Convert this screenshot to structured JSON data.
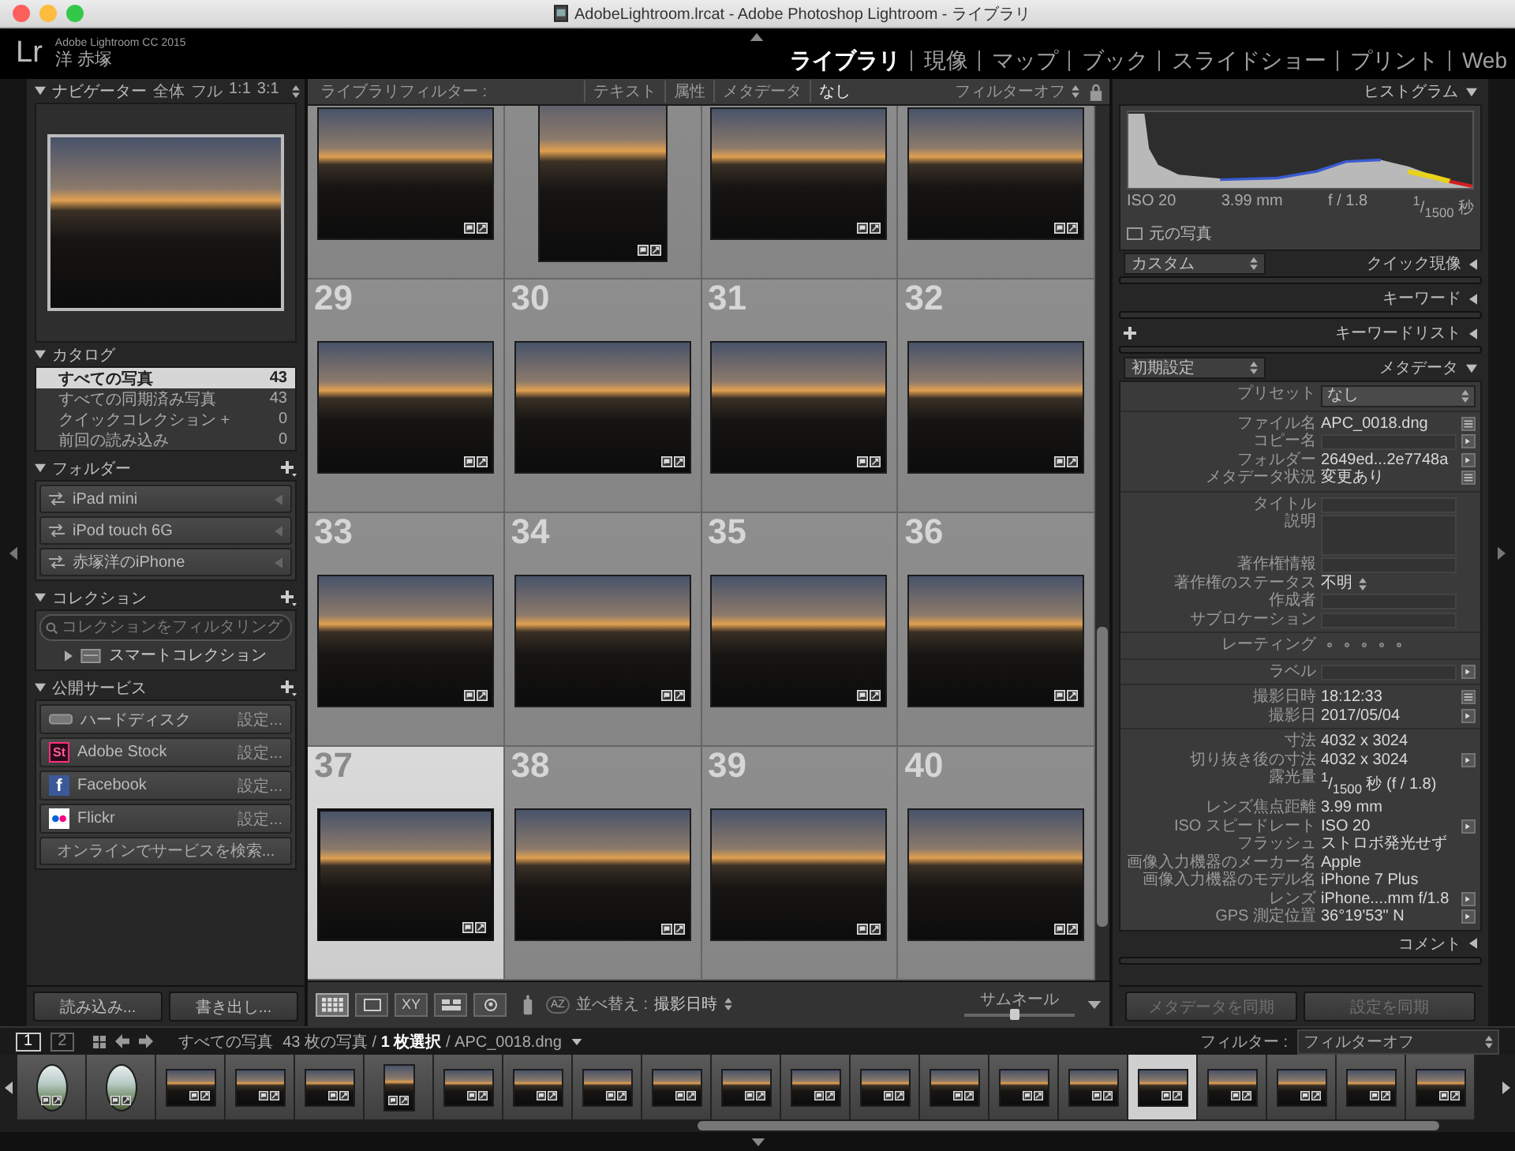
{
  "window": {
    "title": "AdobeLightroom.lrcat - Adobe Photoshop Lightroom - ライブラリ"
  },
  "identity": {
    "logo": "Lr",
    "product": "Adobe Lightroom CC 2015",
    "user": "洋 赤塚"
  },
  "modules": [
    {
      "label": "ライブラリ",
      "selected": true
    },
    {
      "label": "現像",
      "selected": false
    },
    {
      "label": "マップ",
      "selected": false
    },
    {
      "label": "ブック",
      "selected": false
    },
    {
      "label": "スライドショー",
      "selected": false
    },
    {
      "label": "プリント",
      "selected": false
    },
    {
      "label": "Web",
      "selected": false
    }
  ],
  "left_panel": {
    "navigator": {
      "title": "ナビゲーター",
      "zoom_options": [
        "全体",
        "フル",
        "1:1",
        "3:1"
      ]
    },
    "catalog": {
      "title": "カタログ",
      "items": [
        {
          "label": "すべての写真",
          "count": "43",
          "selected": true
        },
        {
          "label": "すべての同期済み写真",
          "count": "43",
          "selected": false
        },
        {
          "label": "クイックコレクション +",
          "count": "0",
          "selected": false
        },
        {
          "label": "前回の読み込み",
          "count": "0",
          "selected": false
        }
      ]
    },
    "folders": {
      "title": "フォルダー",
      "items": [
        "iPad mini",
        "iPod touch 6G",
        "赤塚洋のiPhone"
      ]
    },
    "collections": {
      "title": "コレクション",
      "filter": {
        "placeholder": "コレクションをフィルタリング"
      },
      "items": [
        "スマートコレクション"
      ]
    },
    "publish_services": {
      "title": "公開サービス",
      "items": [
        {
          "kind": "disk",
          "label": "ハードディスク",
          "action": "設定..."
        },
        {
          "kind": "stock",
          "logo_text": "St",
          "label": "Adobe Stock",
          "action": "設定..."
        },
        {
          "kind": "facebook",
          "logo_text": "f",
          "label": "Facebook",
          "action": "設定..."
        },
        {
          "kind": "flickr",
          "label": "Flickr",
          "action": "設定..."
        }
      ],
      "search_button": "オンラインでサービスを検索..."
    },
    "buttons": [
      "読み込み...",
      "書き出し..."
    ]
  },
  "filter_bar": {
    "label": "ライブラリフィルター :",
    "options": [
      {
        "label": "テキスト",
        "selected": false
      },
      {
        "label": "属性",
        "selected": false
      },
      {
        "label": "メタデータ",
        "selected": false
      },
      {
        "label": "なし",
        "selected": true
      }
    ],
    "preset": "フィルターオフ"
  },
  "grid": {
    "cells": [
      {
        "selected": false,
        "portrait": false
      },
      {
        "selected": false,
        "portrait": true
      },
      {
        "selected": false,
        "portrait": false
      },
      {
        "selected": false,
        "portrait": false
      },
      {
        "number": "29",
        "selected": false,
        "portrait": false
      },
      {
        "number": "30",
        "selected": false,
        "portrait": false
      },
      {
        "number": "31",
        "selected": false,
        "portrait": false
      },
      {
        "number": "32",
        "selected": false,
        "portrait": false
      },
      {
        "number": "33",
        "selected": false,
        "portrait": false
      },
      {
        "number": "34",
        "selected": false,
        "portrait": false
      },
      {
        "number": "35",
        "selected": false,
        "portrait": false
      },
      {
        "number": "36",
        "selected": false,
        "portrait": false
      },
      {
        "number": "37",
        "selected": true,
        "portrait": false
      },
      {
        "number": "38",
        "selected": false,
        "portrait": false
      },
      {
        "number": "39",
        "selected": false,
        "portrait": false
      },
      {
        "number": "40",
        "selected": false,
        "portrait": false
      }
    ]
  },
  "toolbar": {
    "view_modes": [
      {
        "kind": "grid",
        "selected": true
      },
      {
        "kind": "loupe",
        "selected": false
      },
      {
        "kind": "compare",
        "glyph": "XY",
        "selected": false
      },
      {
        "kind": "survey",
        "selected": false
      },
      {
        "kind": "people",
        "selected": false
      }
    ],
    "sort_order": "AZ",
    "sort_label": "並べ替え :",
    "sort_value": "撮影日時",
    "thumbnail_label": "サムネール",
    "thumbnail_slider": {
      "level": 0.45
    }
  },
  "right_panel": {
    "histogram": {
      "title": "ヒストグラム",
      "readings": [
        "ISO 20",
        "3.99 mm",
        "f / 1.8",
        "$^{1}$/$_{1500}$ 秒"
      ],
      "original_photo": {
        "label": "元の写真",
        "checked": false
      }
    },
    "quick_develop": {
      "preset": "カスタム",
      "title": "クイック現像"
    },
    "keywording": {
      "title": "キーワード"
    },
    "keyword_list": {
      "title": "キーワードリスト"
    },
    "metadata": {
      "preset": "初期設定",
      "title": "メタデータ",
      "preset_row": {
        "label": "プリセット",
        "value": "なし"
      },
      "groups": [
        [
          {
            "kind": "text",
            "label": "ファイル名",
            "value": "APC_0018.dng",
            "button": {
              "kind": "list"
            }
          },
          {
            "kind": "field",
            "label": "コピー名",
            "button": {
              "kind": "go"
            }
          },
          {
            "kind": "text",
            "label": "フォルダー",
            "value": "2649ed...2e7748a",
            "button": {
              "kind": "go"
            }
          },
          {
            "kind": "text",
            "label": "メタデータ状況",
            "value": "変更あり",
            "button": {
              "kind": "list"
            }
          }
        ],
        [
          {
            "kind": "field",
            "label": "タイトル"
          },
          {
            "kind": "area",
            "label": "説明"
          },
          {
            "kind": "field",
            "label": "著作権情報"
          },
          {
            "kind": "status",
            "label": "著作権のステータス",
            "value": "不明"
          },
          {
            "kind": "field",
            "label": "作成者"
          },
          {
            "kind": "field",
            "label": "サブロケーション"
          }
        ],
        [
          {
            "kind": "rating",
            "label": "レーティング",
            "stars": 0
          }
        ],
        [
          {
            "kind": "field",
            "label": "ラベル",
            "button": {
              "kind": "go"
            }
          }
        ],
        [
          {
            "kind": "text",
            "label": "撮影日時",
            "value": "18:12:33",
            "button": {
              "kind": "list"
            }
          },
          {
            "kind": "text",
            "label": "撮影日",
            "value": "2017/05/04",
            "button": {
              "kind": "go"
            }
          }
        ],
        [
          {
            "kind": "text",
            "label": "寸法",
            "value": "4032 x 3024"
          },
          {
            "kind": "text",
            "label": "切り抜き後の寸法",
            "value": "4032 x 3024",
            "button": {
              "kind": "go"
            }
          },
          {
            "kind": "text",
            "label": "露光量",
            "value": "$^{1}$/$_{1500}$ 秒 (f / 1.8)"
          },
          {
            "kind": "text",
            "label": "レンズ焦点距離",
            "value": "3.99 mm"
          },
          {
            "kind": "text",
            "label": "ISO スピードレート",
            "value": "ISO 20",
            "button": {
              "kind": "go"
            }
          },
          {
            "kind": "text",
            "label": "フラッシュ",
            "value": "ストロボ発光せず"
          },
          {
            "kind": "text",
            "label": "画像入力機器のメーカー名",
            "value": "Apple"
          },
          {
            "kind": "text",
            "label": "画像入力機器のモデル名",
            "value": "iPhone 7 Plus"
          },
          {
            "kind": "text",
            "label": "レンズ",
            "value": "iPhone....mm f/1.8",
            "button": {
              "kind": "go"
            }
          },
          {
            "kind": "text",
            "label": "GPS 測定位置",
            "value": "36°19'53\" N",
            "button": {
              "kind": "go"
            }
          }
        ]
      ]
    },
    "comments": {
      "title": "コメント"
    },
    "sync_buttons": [
      {
        "label": "メタデータを同期",
        "disabled": true
      },
      {
        "label": "設定を同期",
        "disabled": true
      }
    ]
  },
  "filmstrip": {
    "pages": [
      {
        "label": "1",
        "selected": true
      },
      {
        "label": "2",
        "selected": false
      }
    ],
    "source": "すべての写真",
    "info": "43 枚の写真 / **1 枚選択** / APC_0018.dng",
    "filter_label": "フィルター :",
    "filter_value": "フィルターオフ",
    "thumbnails": [
      {
        "kind": "light",
        "portrait": true,
        "selected": false
      },
      {
        "kind": "light",
        "portrait": true,
        "selected": false
      },
      {
        "kind": "dark",
        "portrait": false,
        "selected": false
      },
      {
        "kind": "dark",
        "portrait": false,
        "selected": false
      },
      {
        "kind": "dark",
        "portrait": false,
        "selected": false
      },
      {
        "kind": "dark",
        "portrait": true,
        "selected": false
      },
      {
        "kind": "dark",
        "portrait": false,
        "selected": false
      },
      {
        "kind": "dark",
        "portrait": false,
        "selected": false
      },
      {
        "kind": "dark",
        "portrait": false,
        "selected": false
      },
      {
        "kind": "dark",
        "portrait": false,
        "selected": false
      },
      {
        "kind": "dark",
        "portrait": false,
        "selected": false
      },
      {
        "kind": "dark",
        "portrait": false,
        "selected": false
      },
      {
        "kind": "dark",
        "portrait": false,
        "selected": false
      },
      {
        "kind": "dark",
        "portrait": false,
        "selected": false
      },
      {
        "kind": "dark",
        "portrait": false,
        "selected": false
      },
      {
        "kind": "dark",
        "portrait": false,
        "selected": false
      },
      {
        "kind": "dark",
        "portrait": false,
        "selected": true
      },
      {
        "kind": "dark",
        "portrait": false,
        "selected": false
      },
      {
        "kind": "dark",
        "portrait": false,
        "selected": false
      },
      {
        "kind": "dark",
        "portrait": false,
        "selected": false
      },
      {
        "kind": "dark",
        "portrait": false,
        "selected": false
      }
    ]
  }
}
